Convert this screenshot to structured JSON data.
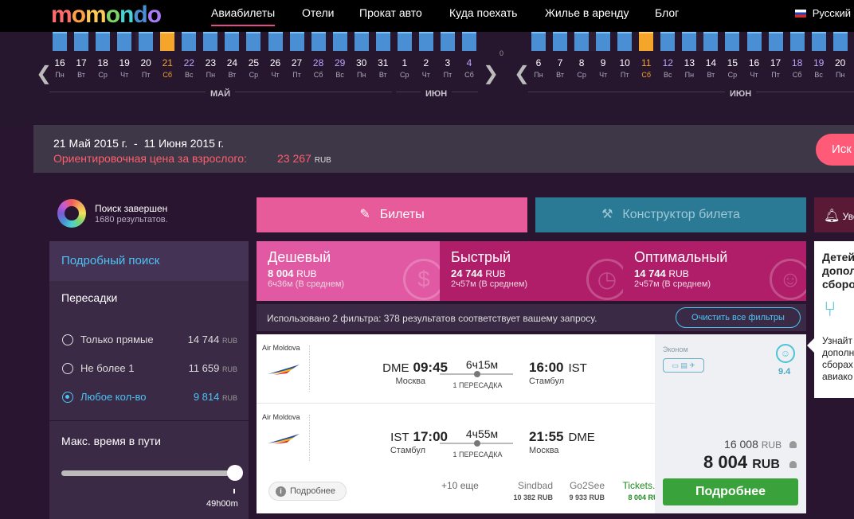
{
  "nav": {
    "logo": "momondo",
    "items": [
      "Авиабилеты",
      "Отели",
      "Прокат авто",
      "Куда поехать",
      "Жилье в аренду",
      "Блог"
    ],
    "language": "Русский"
  },
  "calendar": {
    "left": {
      "days": [
        {
          "d": "16",
          "w": "Пн"
        },
        {
          "d": "17",
          "w": "Вт"
        },
        {
          "d": "18",
          "w": "Ср"
        },
        {
          "d": "19",
          "w": "Чт"
        },
        {
          "d": "20",
          "w": "Пт"
        },
        {
          "d": "21",
          "w": "Сб"
        },
        {
          "d": "22",
          "w": "Вс"
        },
        {
          "d": "23",
          "w": "Пн"
        },
        {
          "d": "24",
          "w": "Вт"
        },
        {
          "d": "25",
          "w": "Ср"
        },
        {
          "d": "26",
          "w": "Чт"
        },
        {
          "d": "27",
          "w": "Пт"
        },
        {
          "d": "28",
          "w": "Сб"
        },
        {
          "d": "29",
          "w": "Вс"
        },
        {
          "d": "30",
          "w": "Пн"
        },
        {
          "d": "31",
          "w": "Вт"
        },
        {
          "d": "1",
          "w": "Ср"
        },
        {
          "d": "2",
          "w": "Чт"
        },
        {
          "d": "3",
          "w": "Пт"
        },
        {
          "d": "4",
          "w": "Сб"
        }
      ],
      "selected_index": 5,
      "month_1": "МАЙ",
      "month_2": "ИЮН"
    },
    "center_label": "0",
    "right": {
      "days": [
        {
          "d": "6",
          "w": "Пн"
        },
        {
          "d": "7",
          "w": "Вт"
        },
        {
          "d": "8",
          "w": "Ср"
        },
        {
          "d": "9",
          "w": "Чт"
        },
        {
          "d": "10",
          "w": "Пт"
        },
        {
          "d": "11",
          "w": "Сб"
        },
        {
          "d": "12",
          "w": "Вс"
        },
        {
          "d": "13",
          "w": "Пн"
        },
        {
          "d": "14",
          "w": "Вт"
        },
        {
          "d": "15",
          "w": "Ср"
        },
        {
          "d": "16",
          "w": "Чт"
        },
        {
          "d": "17",
          "w": "Пт"
        },
        {
          "d": "18",
          "w": "Сб"
        },
        {
          "d": "19",
          "w": "Вс"
        },
        {
          "d": "20",
          "w": "Пн"
        }
      ],
      "selected_index": 5,
      "month": "ИЮН"
    },
    "prev_arrow": "❮",
    "next_arrow": "❯"
  },
  "summary": {
    "date_from": "21 Май 2015 г.",
    "sep": "-",
    "date_to": "11 Июня 2015 г.",
    "price_label": "Ориентировочная цена за взрослого:",
    "price": "23 267",
    "currency": "RUB",
    "search_button": "Иск"
  },
  "status": {
    "title": "Поиск завершен",
    "count": "1680 результатов."
  },
  "filters": {
    "title": "Подробный поиск",
    "stops_title": "Пересадки",
    "options": [
      {
        "label": "Только прямые",
        "price": "14 744",
        "cur": "RUB",
        "selected": false
      },
      {
        "label": "Не более 1",
        "price": "11 659",
        "cur": "RUB",
        "selected": false
      },
      {
        "label": "Любое кол-во",
        "price": "9 814",
        "cur": "RUB",
        "selected": true
      }
    ],
    "time_title": "Макс. время в пути",
    "time_value": "49h00m"
  },
  "tabs": {
    "tickets": "Билеты",
    "builder": "Конструктор билета",
    "alert": "Уве"
  },
  "sort": [
    {
      "title": "Дешевый",
      "price": "8 004",
      "cur": "RUB",
      "desc": "6ч36м (В среднем)",
      "deco": "$"
    },
    {
      "title": "Быстрый",
      "price": "24 744",
      "cur": "RUB",
      "desc": "2ч57м (В среднем)",
      "deco": "◷"
    },
    {
      "title": "Оптимальный",
      "price": "14 744",
      "cur": "RUB",
      "desc": "2ч57м (В среднем)",
      "deco": "☺"
    }
  ],
  "filter_info": {
    "text": "Использовано 2 фильтра: 378 результатов соответствует вашему запросу.",
    "clear": "Очистить все фильтры"
  },
  "result": {
    "legs": [
      {
        "airline": "Air Moldova",
        "dep_code": "DME",
        "dep_time": "09:45",
        "dep_city": "Москва",
        "duration": "6ч15м",
        "stops": "1 ПЕРЕСАДКА",
        "arr_time": "16:00",
        "arr_code": "IST",
        "arr_city": "Стамбул"
      },
      {
        "airline": "Air Moldova",
        "dep_code": "IST",
        "dep_time": "17:00",
        "dep_city": "Стамбул",
        "duration": "4ч55м",
        "stops": "1 ПЕРЕСАДКА",
        "arr_time": "21:55",
        "arr_code": "DME",
        "arr_city": "Москва"
      }
    ],
    "class": "Эконом",
    "rating": "9.4",
    "details_link": "Подробнее",
    "more_count": "+10 еще",
    "providers": [
      {
        "name": "Sindbad",
        "price": "10 382 RUB"
      },
      {
        "name": "Go2See",
        "price": "9 933 RUB"
      },
      {
        "name": "Tickets.ru",
        "price": "8 004 RUB"
      }
    ],
    "price_total": "16 008",
    "price_total_cur": "RUB",
    "price_per": "8 004",
    "price_per_cur": "RUB",
    "book_button": "Подробнее"
  },
  "popup": {
    "title": "Детей допол сборо",
    "text": "Узнайт дополн сборах авиако агентс"
  }
}
